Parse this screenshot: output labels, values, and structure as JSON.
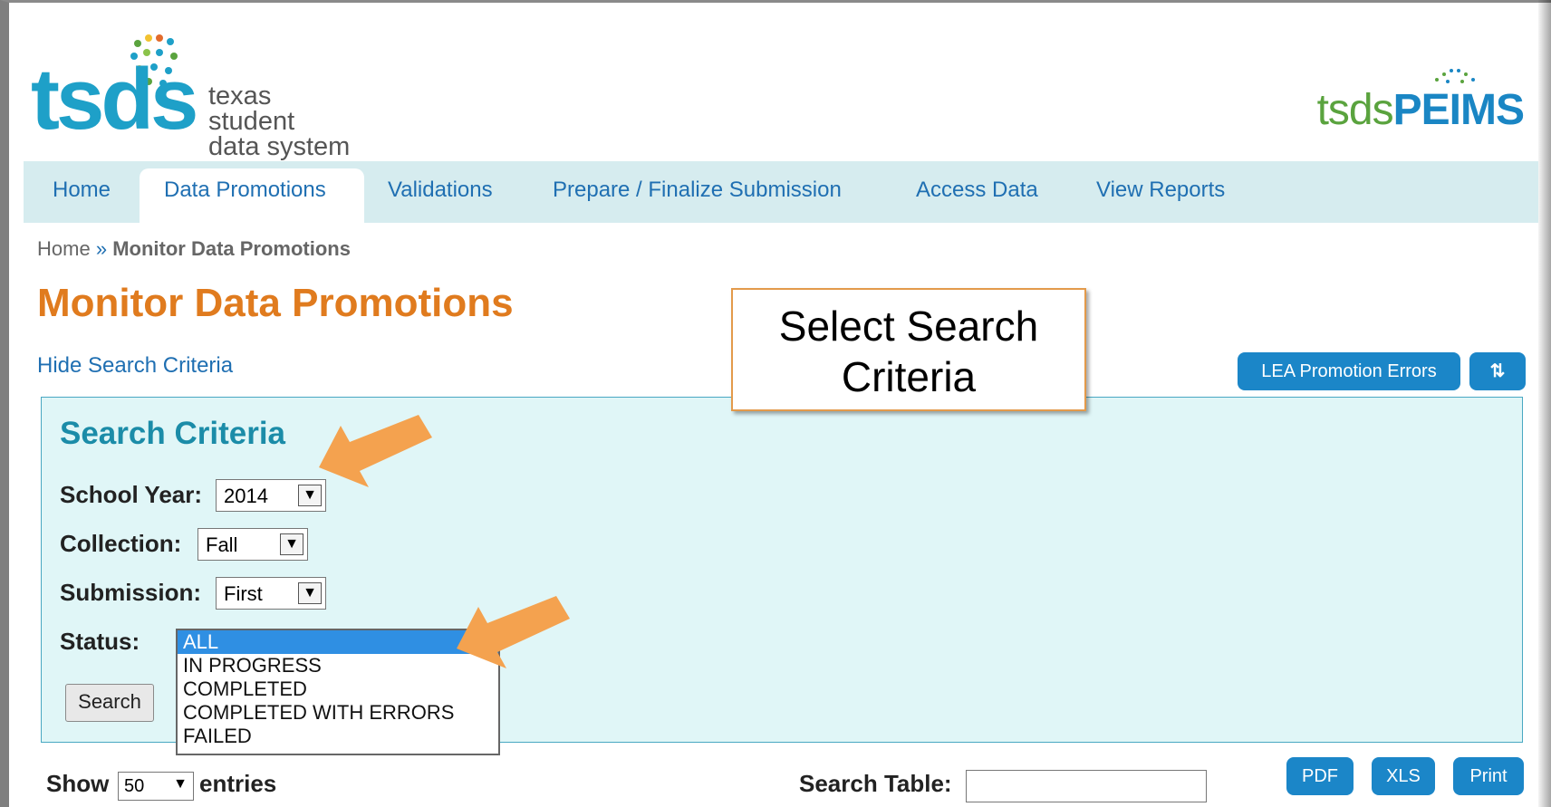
{
  "header": {
    "logo_word": "tsds",
    "logo_line1": "texas student",
    "logo_line2": "data system",
    "peims_prefix": "tsds",
    "peims_suffix": "PEIMS"
  },
  "nav": {
    "items": [
      {
        "label": "Home"
      },
      {
        "label": "Data Promotions"
      },
      {
        "label": "Validations"
      },
      {
        "label": "Prepare / Finalize Submission"
      },
      {
        "label": "Access Data"
      },
      {
        "label": "View Reports"
      }
    ],
    "active": "Data Promotions"
  },
  "breadcrumb": {
    "home": "Home",
    "separator": "»",
    "current": "Monitor Data Promotions"
  },
  "page_title": "Monitor Data Promotions",
  "hide_search_link": "Hide Search Criteria",
  "buttons": {
    "lea_errors": "LEA Promotion Errors",
    "refresh_icon": "refresh-icon",
    "pdf": "PDF",
    "xls": "XLS",
    "print": "Print"
  },
  "search_panel": {
    "title": "Search Criteria",
    "school_year_label": "School Year:",
    "school_year_value": "2014",
    "collection_label": "Collection:",
    "collection_value": "Fall",
    "submission_label": "Submission:",
    "submission_value": "First",
    "status_label": "Status:",
    "status_options": [
      "ALL",
      "IN PROGRESS",
      "COMPLETED",
      "COMPLETED WITH ERRORS",
      "FAILED"
    ],
    "status_selected": "ALL",
    "search_button": "Search"
  },
  "table_controls": {
    "show_label": "Show",
    "entries_value": "50",
    "entries_label": "entries",
    "search_table_label": "Search Table:"
  },
  "callout": {
    "line1": "Select Search",
    "line2": "Criteria"
  },
  "colors": {
    "brand_blue": "#1ea0c8",
    "link_blue": "#1f6fb2",
    "title_orange": "#e07b1e",
    "panel_bg": "#e0f6f7",
    "button_blue": "#1b86c8",
    "arrow_orange": "#f4a24f"
  }
}
